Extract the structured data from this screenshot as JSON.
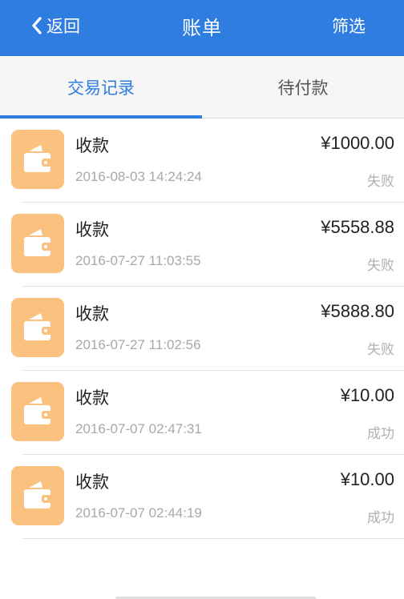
{
  "header": {
    "back_label": "返回",
    "title": "账单",
    "filter_label": "筛选"
  },
  "tabs": [
    {
      "label": "交易记录",
      "active": true
    },
    {
      "label": "待付款",
      "active": false
    }
  ],
  "transactions": [
    {
      "title": "收款",
      "time": "2016-08-03 14:24:24",
      "amount": "¥1000.00",
      "status": "失败"
    },
    {
      "title": "收款",
      "time": "2016-07-27 11:03:55",
      "amount": "¥5558.88",
      "status": "失败"
    },
    {
      "title": "收款",
      "time": "2016-07-27 11:02:56",
      "amount": "¥5888.80",
      "status": "失败"
    },
    {
      "title": "收款",
      "time": "2016-07-07 02:47:31",
      "amount": "¥10.00",
      "status": "成功"
    },
    {
      "title": "收款",
      "time": "2016-07-07 02:44:19",
      "amount": "¥10.00",
      "status": "成功"
    }
  ],
  "icons": {
    "back": "chevron-left-icon",
    "transaction": "wallet-icon"
  },
  "colors": {
    "primary": "#2f7de1",
    "wallet_icon_bg": "#fbc27f",
    "secondary_text": "#a8a8a8"
  }
}
